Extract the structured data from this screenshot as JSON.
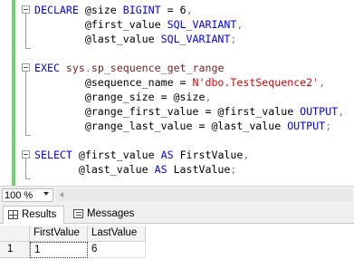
{
  "editor": {
    "lines": [
      [
        {
          "t": "DECLARE",
          "c": "kw"
        },
        {
          "t": " @size ",
          "c": ""
        },
        {
          "t": "BIGINT",
          "c": "kw"
        },
        {
          "t": " = 6",
          "c": ""
        },
        {
          "t": ",",
          "c": "op"
        }
      ],
      [
        {
          "t": "        @first_value ",
          "c": ""
        },
        {
          "t": "SQL_VARIANT",
          "c": "kw"
        },
        {
          "t": ",",
          "c": "op"
        }
      ],
      [
        {
          "t": "        @last_value ",
          "c": ""
        },
        {
          "t": "SQL_VARIANT",
          "c": "kw"
        },
        {
          "t": ";",
          "c": "op"
        }
      ],
      [],
      [
        {
          "t": "EXEC",
          "c": "kw"
        },
        {
          "t": " ",
          "c": ""
        },
        {
          "t": "sys",
          "c": "fn"
        },
        {
          "t": ".",
          "c": "op"
        },
        {
          "t": "sp_sequence_get_range",
          "c": "fn"
        }
      ],
      [
        {
          "t": "        @sequence_name = ",
          "c": ""
        },
        {
          "t": "N'dbo.TestSequence2'",
          "c": "str"
        },
        {
          "t": ",",
          "c": "op"
        }
      ],
      [
        {
          "t": "        @range_size = @size",
          "c": ""
        },
        {
          "t": ",",
          "c": "op"
        }
      ],
      [
        {
          "t": "        @range_first_value = @first_value ",
          "c": ""
        },
        {
          "t": "OUTPUT",
          "c": "kw"
        },
        {
          "t": ",",
          "c": "op"
        }
      ],
      [
        {
          "t": "        @range_last_value = @last_value ",
          "c": ""
        },
        {
          "t": "OUTPUT",
          "c": "kw"
        },
        {
          "t": ";",
          "c": "op"
        }
      ],
      [],
      [
        {
          "t": "SELECT",
          "c": "kw"
        },
        {
          "t": " @first_value ",
          "c": ""
        },
        {
          "t": "AS",
          "c": "kw"
        },
        {
          "t": " FirstValue",
          "c": ""
        },
        {
          "t": ",",
          "c": "op"
        }
      ],
      [
        {
          "t": "       @last_value ",
          "c": ""
        },
        {
          "t": "AS",
          "c": "kw"
        },
        {
          "t": " LastValue",
          "c": ""
        },
        {
          "t": ";",
          "c": "op"
        }
      ]
    ]
  },
  "statusbar": {
    "zoom": "100 %"
  },
  "tabs": {
    "results": "Results",
    "messages": "Messages"
  },
  "grid": {
    "columns": [
      "FirstValue",
      "LastValue"
    ],
    "rows": [
      {
        "num": "1",
        "cells": [
          "1",
          "6"
        ]
      }
    ]
  },
  "colors": {
    "keyword": "#0000ff",
    "function": "#7a1f1f",
    "string": "#e00000",
    "operator": "#808080",
    "change_bar": "#6ed36e"
  },
  "icons": {
    "results_tab": "grid-icon",
    "messages_tab": "message-icon",
    "fold": "collapse-icon"
  }
}
